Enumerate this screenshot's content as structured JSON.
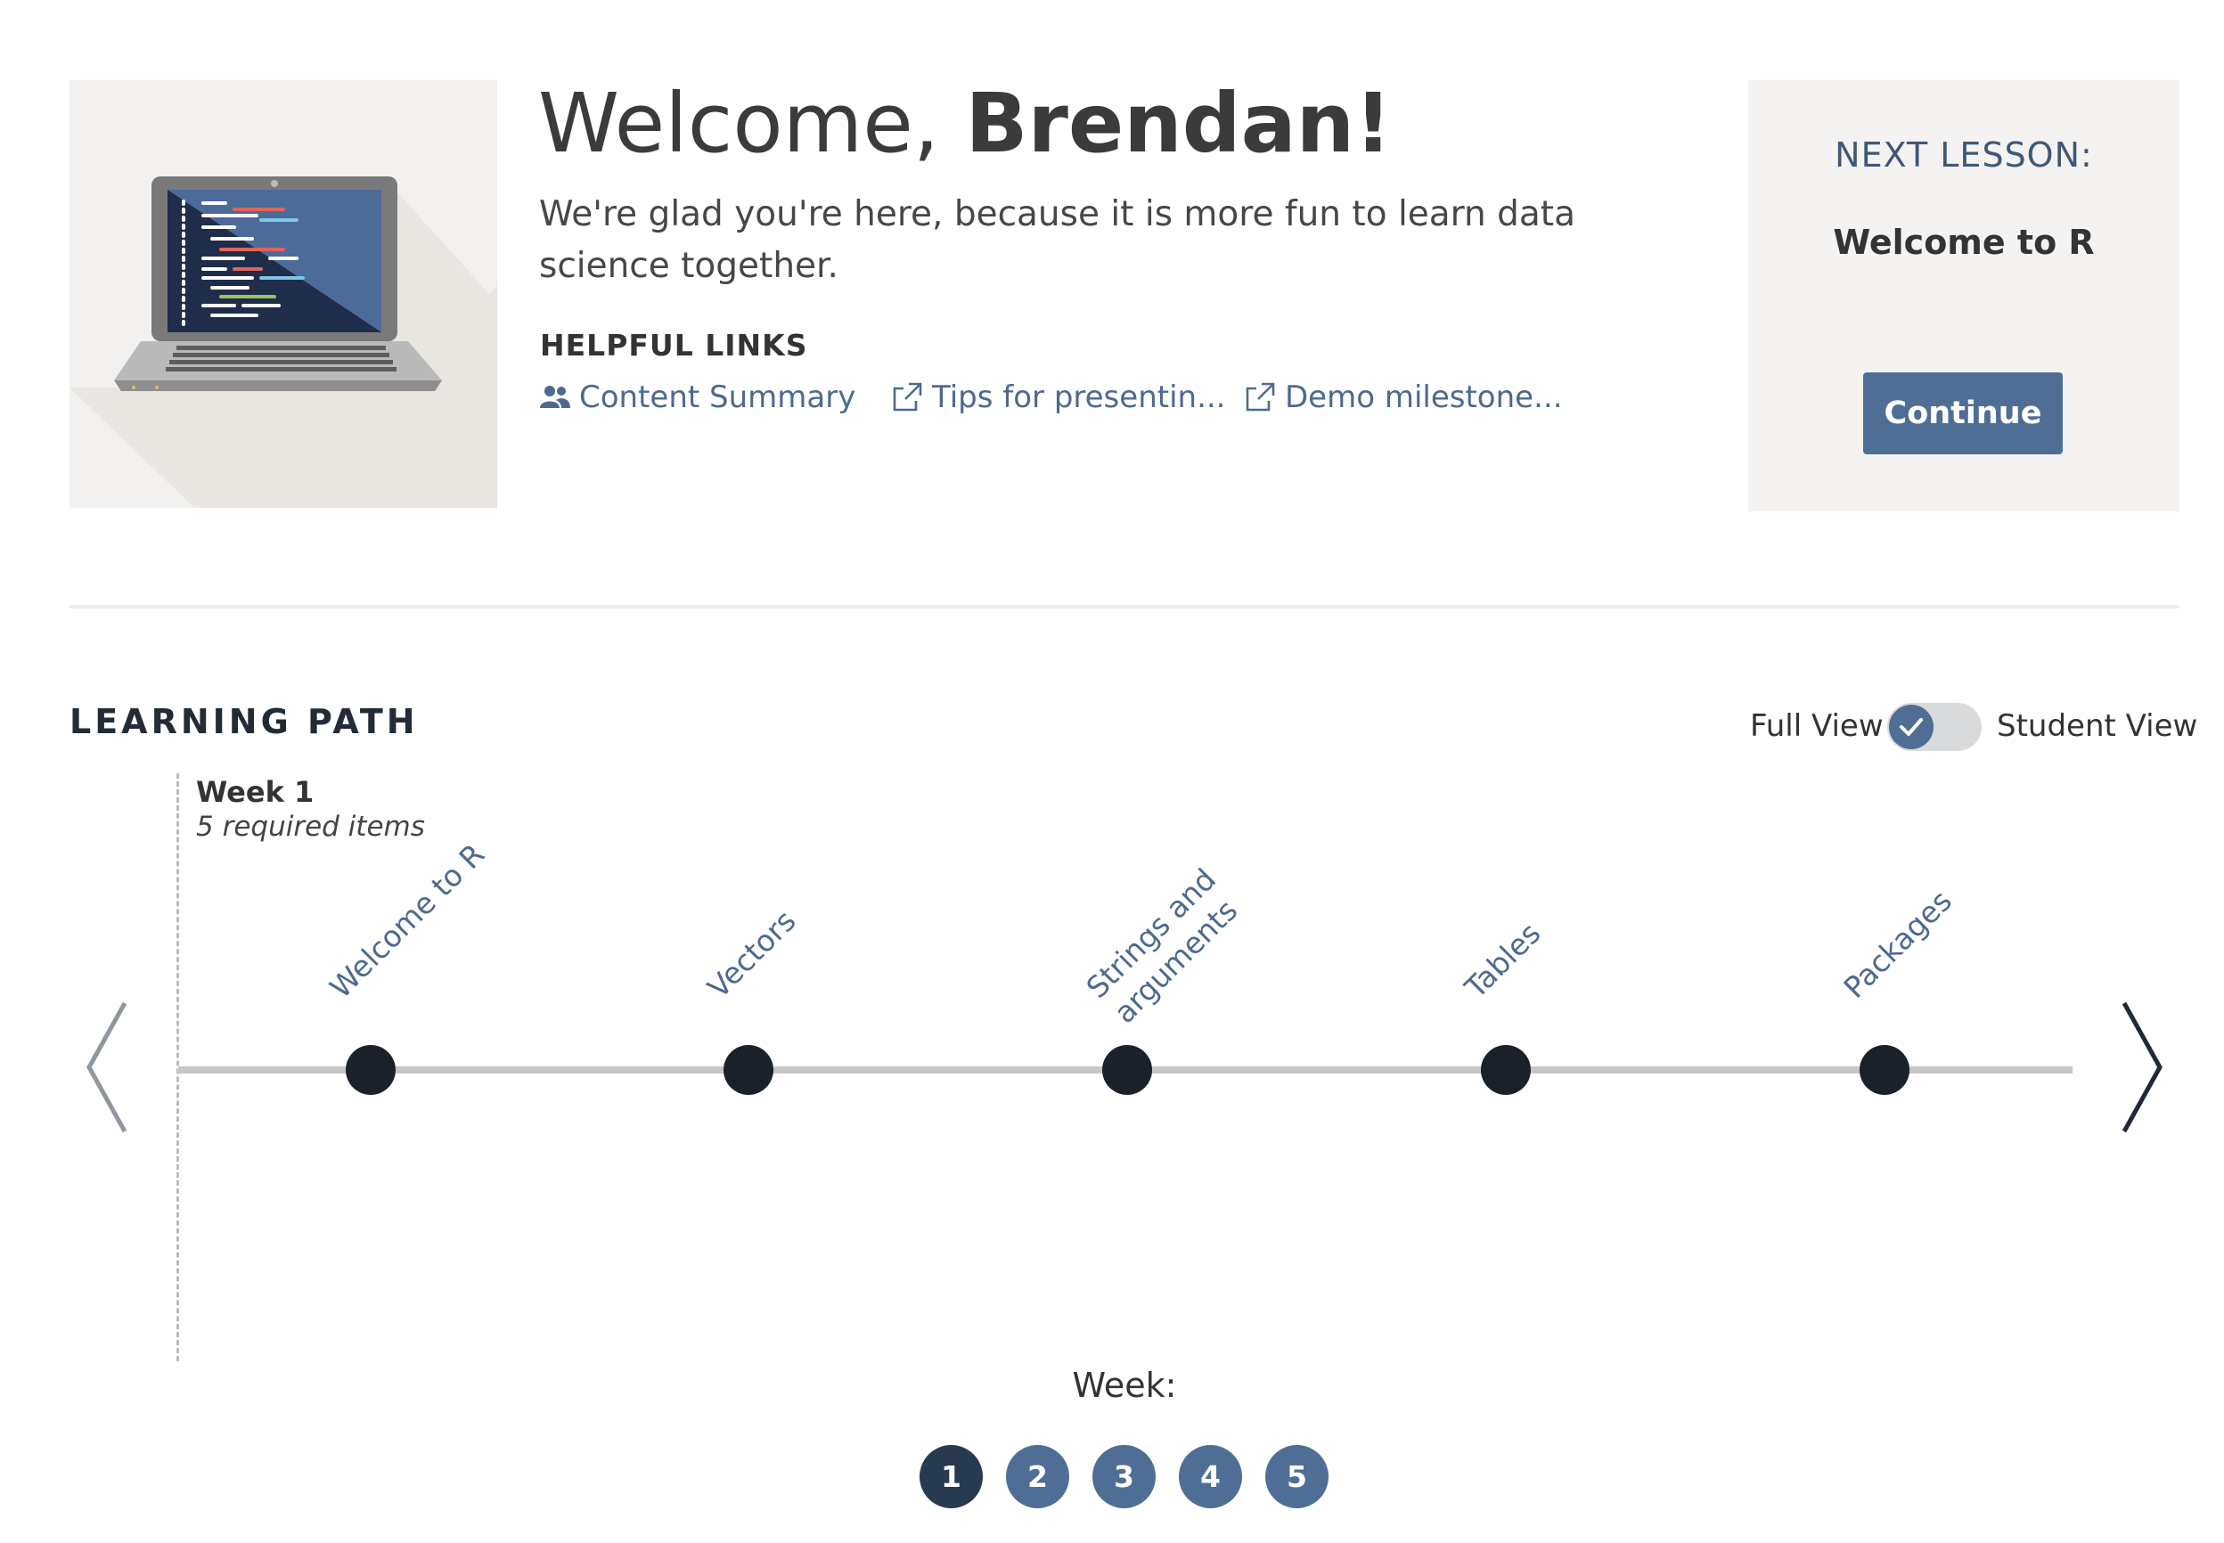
{
  "welcome": {
    "greeting": "Welcome, ",
    "name": "Brendan!",
    "subtitle": "We're glad you're here, because it is more fun to learn data science together."
  },
  "helpful_links": {
    "title": "HELPFUL LINKS",
    "items": [
      {
        "label": "Content Summary",
        "icon": "people-icon"
      },
      {
        "label": "Tips for presentin...",
        "icon": "external-link-icon"
      },
      {
        "label": "Demo milestone...",
        "icon": "external-link-icon"
      }
    ]
  },
  "next_lesson": {
    "label": "NEXT LESSON:",
    "lesson": "Welcome to R",
    "button": "Continue"
  },
  "learning_path": {
    "title": "LEARNING PATH",
    "view_toggle": {
      "left_label": "Full View",
      "right_label": "Student View",
      "checked": true
    },
    "week": {
      "name": "Week 1",
      "required": "5 required items"
    },
    "lessons": [
      {
        "line1": "Welcome to R",
        "line2": ""
      },
      {
        "line1": "Vectors",
        "line2": ""
      },
      {
        "line1": "Strings and",
        "line2": "arguments"
      },
      {
        "line1": "Tables",
        "line2": ""
      },
      {
        "line1": "Packages",
        "line2": ""
      }
    ],
    "week_nav": {
      "label": "Week:",
      "weeks": [
        "1",
        "2",
        "3",
        "4",
        "5"
      ],
      "active": "1"
    }
  },
  "colors": {
    "accent": "#4f6e95",
    "dark_node": "#1a212b",
    "active_week": "#283a50",
    "panel_bg": "#f4f3f1"
  }
}
